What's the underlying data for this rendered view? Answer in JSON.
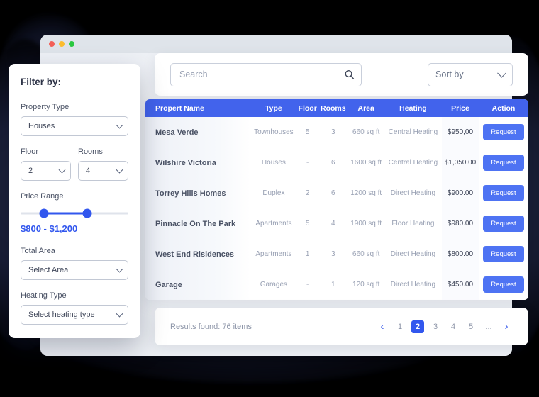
{
  "window": {
    "traffic_lights": [
      "close",
      "minimize",
      "maximize"
    ]
  },
  "search": {
    "placeholder": "Search",
    "value": "",
    "icon": "search-icon"
  },
  "sort": {
    "label": "Sort by",
    "icon": "chevron-down-icon"
  },
  "sidebar": {
    "title": "Filter by:",
    "property_type": {
      "label": "Property Type",
      "value": "Houses"
    },
    "floor": {
      "label": "Floor",
      "value": "2"
    },
    "rooms": {
      "label": "Rooms",
      "value": "4"
    },
    "price_range": {
      "label": "Price Range",
      "value": "$800 - $1,200",
      "min": 800,
      "max": 1200
    },
    "total_area": {
      "label": "Total Area",
      "value": "Select Area"
    },
    "heating_type": {
      "label": "Heating Type",
      "value": "Select heating type"
    }
  },
  "table": {
    "columns": [
      "Propert Name",
      "Type",
      "Floor",
      "Rooms",
      "Area",
      "Heating",
      "Price",
      "Action"
    ],
    "action_label": "Request",
    "rows": [
      {
        "name": "Mesa Verde",
        "type": "Townhouses",
        "floor": "5",
        "rooms": "3",
        "area": "660 sq ft",
        "heating": "Central Heating",
        "price": "$950,00"
      },
      {
        "name": "Wilshire Victoria",
        "type": "Houses",
        "floor": "-",
        "rooms": "6",
        "area": "1600 sq ft",
        "heating": "Central Heating",
        "price": "$1,050.00"
      },
      {
        "name": "Torrey Hills Homes",
        "type": "Duplex",
        "floor": "2",
        "rooms": "6",
        "area": "1200 sq ft",
        "heating": "Direct Heating",
        "price": "$900.00"
      },
      {
        "name": "Pinnacle On The Park",
        "type": "Apartments",
        "floor": "5",
        "rooms": "4",
        "area": "1900 sq ft",
        "heating": "Floor Heating",
        "price": "$980.00"
      },
      {
        "name": "West End Risidences",
        "type": "Apartments",
        "floor": "1",
        "rooms": "3",
        "area": "660 sq ft",
        "heating": "Direct Heating",
        "price": "$800.00"
      },
      {
        "name": "Garage",
        "type": "Garages",
        "floor": "-",
        "rooms": "1",
        "area": "120 sq ft",
        "heating": "Direct Heating",
        "price": "$450.00"
      }
    ]
  },
  "footer": {
    "results_text": "Results found:  76 items",
    "prev_icon": "chevron-left-icon",
    "next_icon": "chevron-right-icon",
    "pages": [
      "1",
      "2",
      "3",
      "4",
      "5",
      "..."
    ],
    "active_page": "2"
  },
  "colors": {
    "accent": "#3257ee",
    "header": "#4263ec",
    "button": "#4e73f3",
    "background": "#000000"
  }
}
